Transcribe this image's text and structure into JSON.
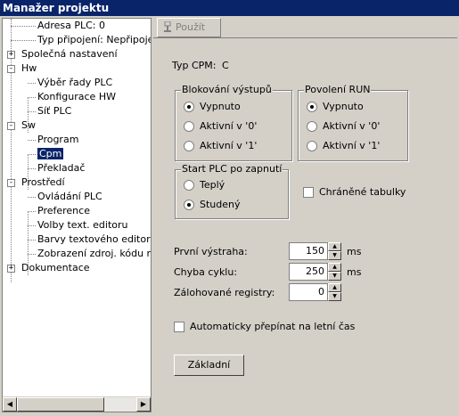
{
  "window": {
    "title": "Manažer projektu"
  },
  "tree": {
    "items": [
      {
        "label": "Adresa PLC: 0",
        "name": "tree-item-adresa-plc"
      },
      {
        "label": "Typ připojení: Nepřipojeno",
        "name": "tree-item-typ-pripojeni"
      },
      {
        "label": "Společná nastavení",
        "name": "tree-item-spolecna-nastaveni",
        "expander": "+"
      },
      {
        "label": "Hw",
        "name": "tree-item-hw",
        "expander": "-"
      },
      {
        "label": "Výběr řady PLC",
        "name": "tree-item-vyber-rady-plc"
      },
      {
        "label": "Konfigurace HW",
        "name": "tree-item-konfigurace-hw"
      },
      {
        "label": "Síť PLC",
        "name": "tree-item-sit-plc"
      },
      {
        "label": "Sw",
        "name": "tree-item-sw",
        "expander": "-"
      },
      {
        "label": "Program",
        "name": "tree-item-program"
      },
      {
        "label": "Cpm",
        "name": "tree-item-cpm",
        "selected": true
      },
      {
        "label": "Překladač",
        "name": "tree-item-prekladac"
      },
      {
        "label": "Prostředí",
        "name": "tree-item-prostredi",
        "expander": "-"
      },
      {
        "label": "Ovládání PLC",
        "name": "tree-item-ovladani-plc"
      },
      {
        "label": "Preference",
        "name": "tree-item-preference"
      },
      {
        "label": "Volby text. editoru",
        "name": "tree-item-volby-text-editoru"
      },
      {
        "label": "Barvy textového editoru",
        "name": "tree-item-barvy-textoveho-editoru"
      },
      {
        "label": "Zobrazení zdroj. kódu reléo",
        "name": "tree-item-zobrazeni-zdroj-kodu"
      },
      {
        "label": "Dokumentace",
        "name": "tree-item-dokumentace",
        "expander": "+"
      }
    ]
  },
  "toolbar": {
    "apply_label": "Použít"
  },
  "cpm": {
    "type_label": "Typ CPM:",
    "type_value": "C",
    "blocking": {
      "title": "Blokování výstupů",
      "options": [
        "Vypnuto",
        "Aktivní v '0'",
        "Aktivní v '1'"
      ],
      "selected": 0
    },
    "run": {
      "title": "Povolení RUN",
      "options": [
        "Vypnuto",
        "Aktivní v '0'",
        "Aktivní v '1'"
      ],
      "selected": 0
    },
    "start": {
      "title": "Start PLC po zapnutí",
      "options": [
        "Teplý",
        "Studený"
      ],
      "selected": 1
    },
    "protected_tables": {
      "label": "Chráněné tabulky",
      "checked": false
    },
    "first_warning": {
      "label": "První výstraha:",
      "value": "150",
      "unit": "ms"
    },
    "cycle_error": {
      "label": "Chyba cyklu:",
      "value": "250",
      "unit": "ms"
    },
    "backup_registers": {
      "label": "Zálohované registry:",
      "value": "0"
    },
    "dst": {
      "label": "Automaticky přepínat na letní čas",
      "checked": false
    },
    "default_button": "Základní"
  },
  "colors": {
    "title_bar": "#0a246a",
    "selection": "#0a246a",
    "face": "#d4d0c8"
  }
}
